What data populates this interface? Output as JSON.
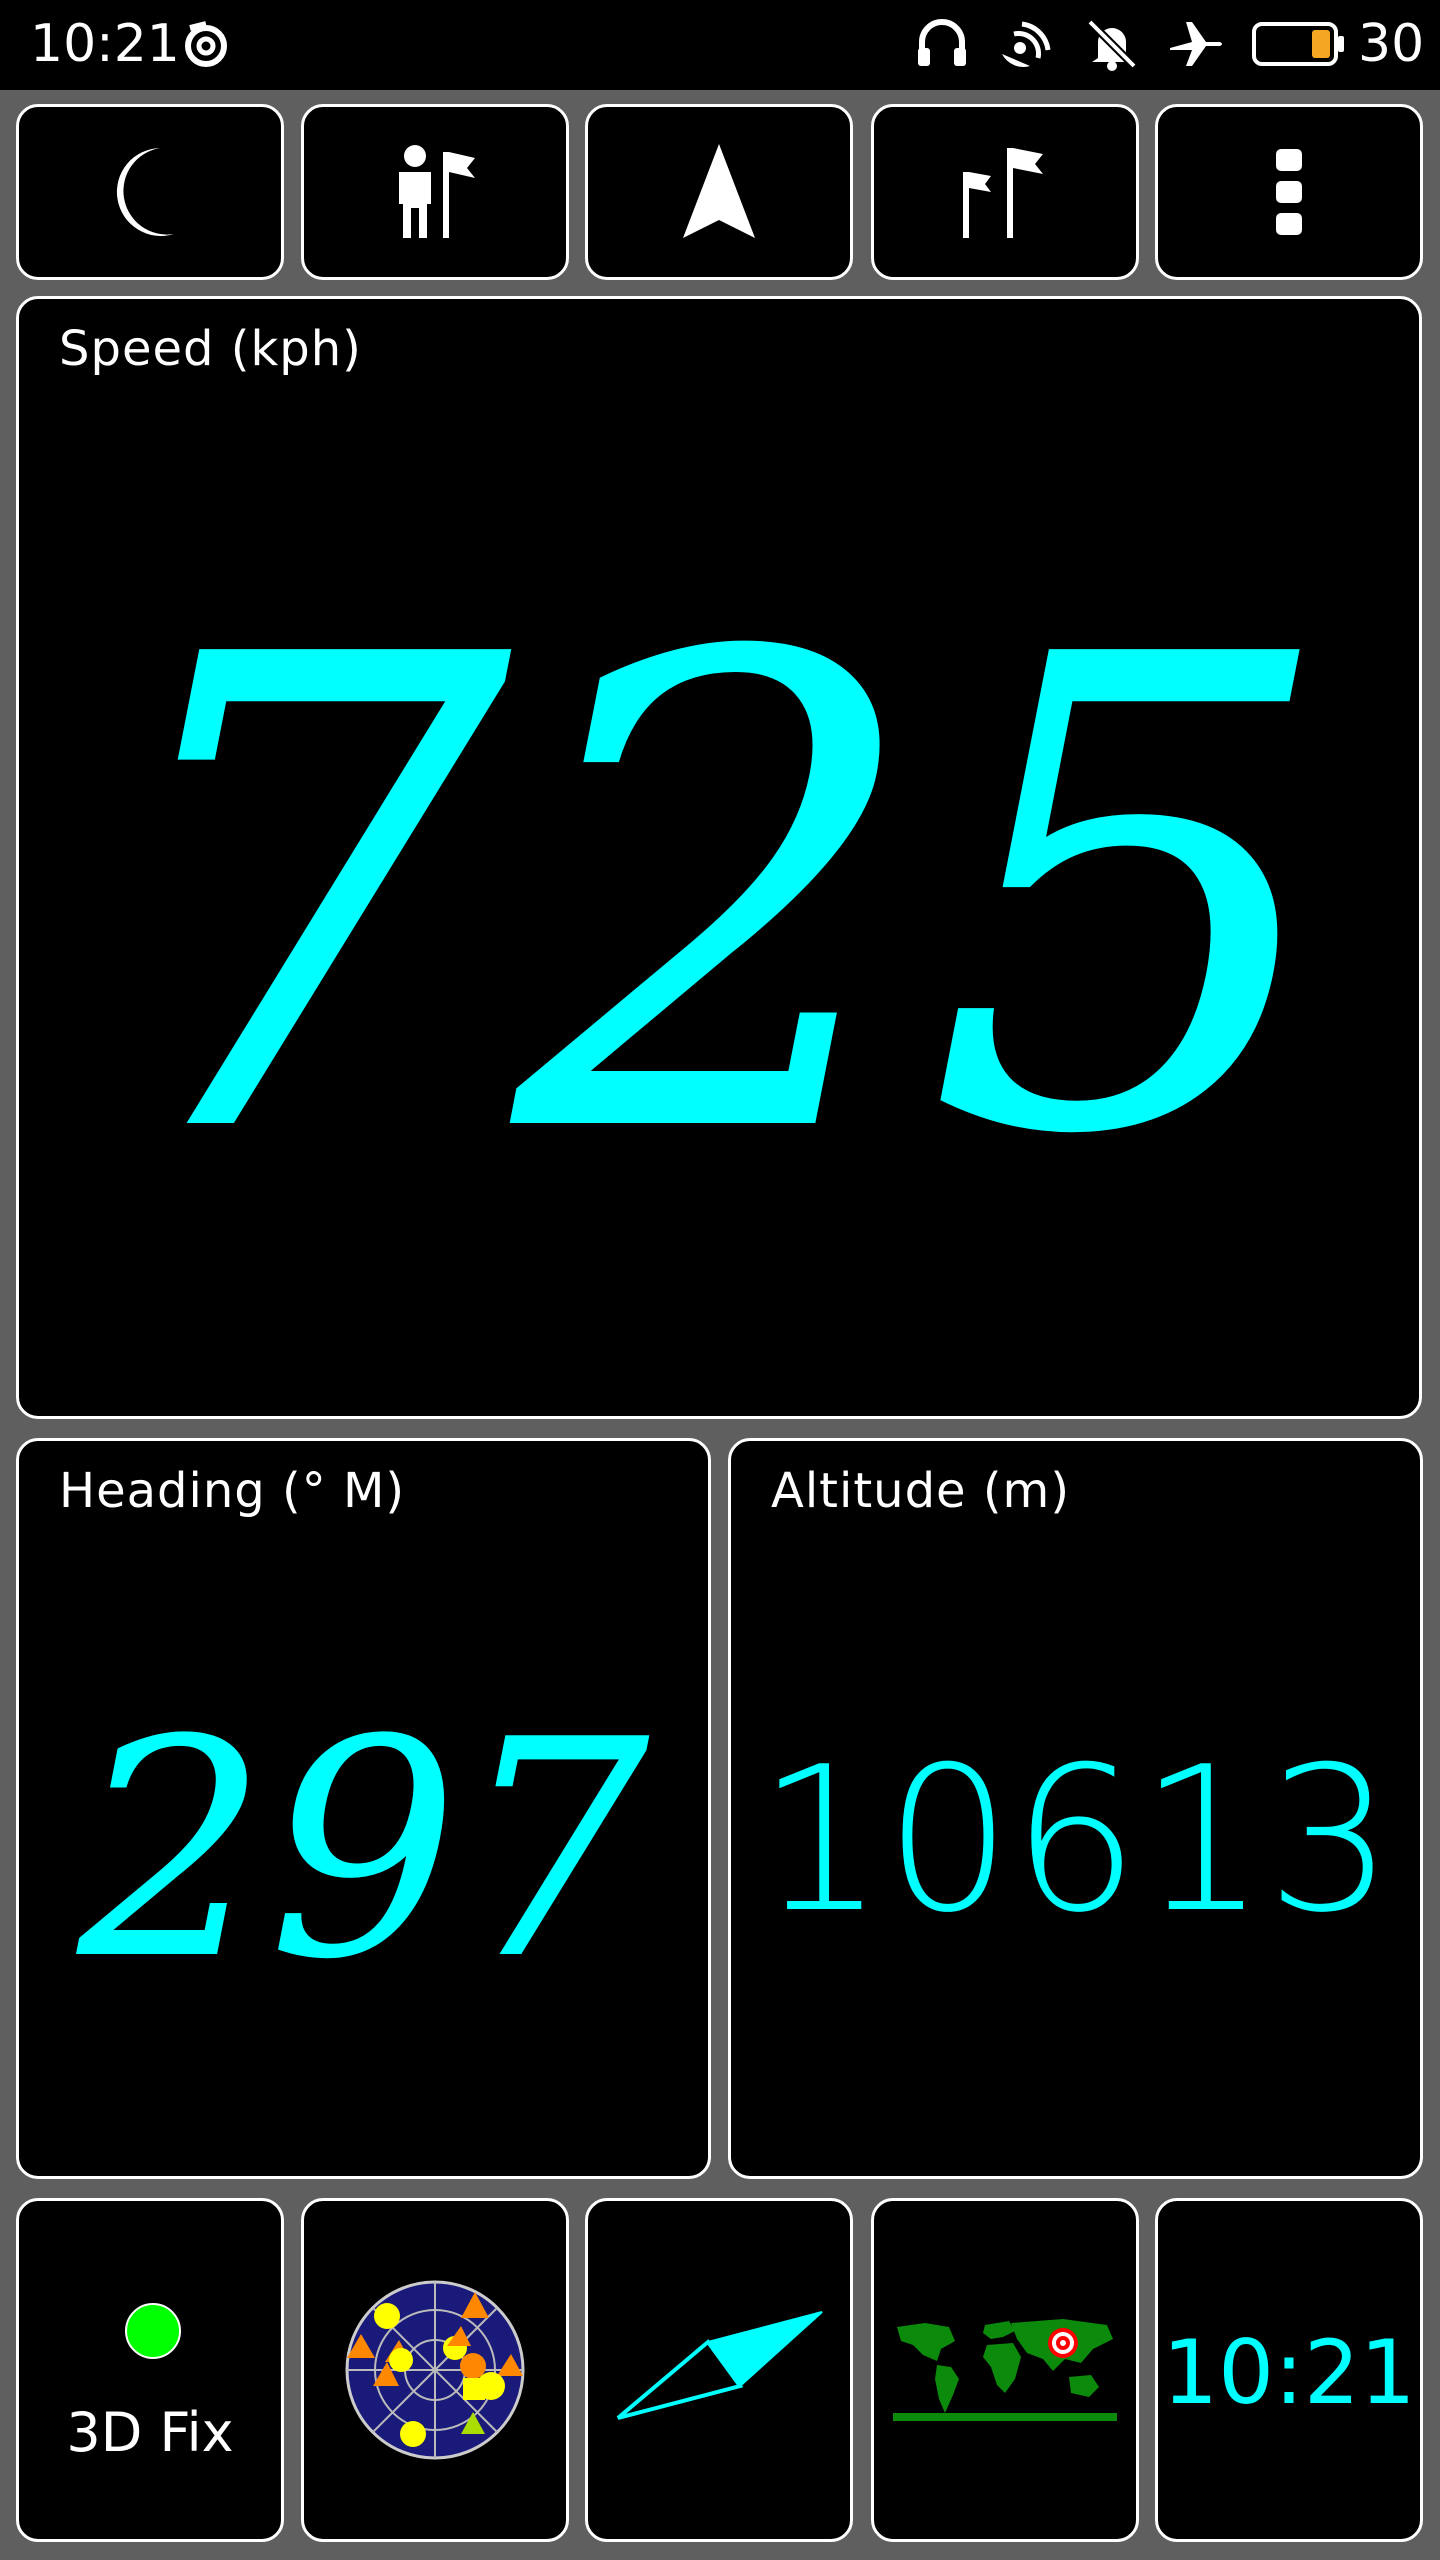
{
  "status_bar": {
    "time": "10:21",
    "battery_level": "30",
    "icons": [
      "app-spiral-icon",
      "headphones-icon",
      "hotspot-icon",
      "silent-bell-icon",
      "airplane-mode-icon",
      "battery-icon"
    ]
  },
  "toolbar": {
    "buttons": [
      {
        "name": "night-mode-button",
        "icon": "moon-icon"
      },
      {
        "name": "waypoint-person-button",
        "icon": "person-flag-icon"
      },
      {
        "name": "navigation-button",
        "icon": "navigation-arrow-icon"
      },
      {
        "name": "route-flags-button",
        "icon": "double-flag-icon"
      },
      {
        "name": "more-options-button",
        "icon": "more-vertical-icon"
      }
    ]
  },
  "speed": {
    "label": "Speed (kph)",
    "value": "725"
  },
  "heading": {
    "label": "Heading (°  M)",
    "value": "297"
  },
  "altitude": {
    "label": "Altitude (m)",
    "value": "10613"
  },
  "bottom_bar": {
    "fix_status": "3D Fix",
    "fix_color": "#00ff00",
    "clock": "10:21"
  },
  "colors": {
    "accent": "#00ffff",
    "background": "#000000",
    "frame": "#5f5f5f"
  }
}
